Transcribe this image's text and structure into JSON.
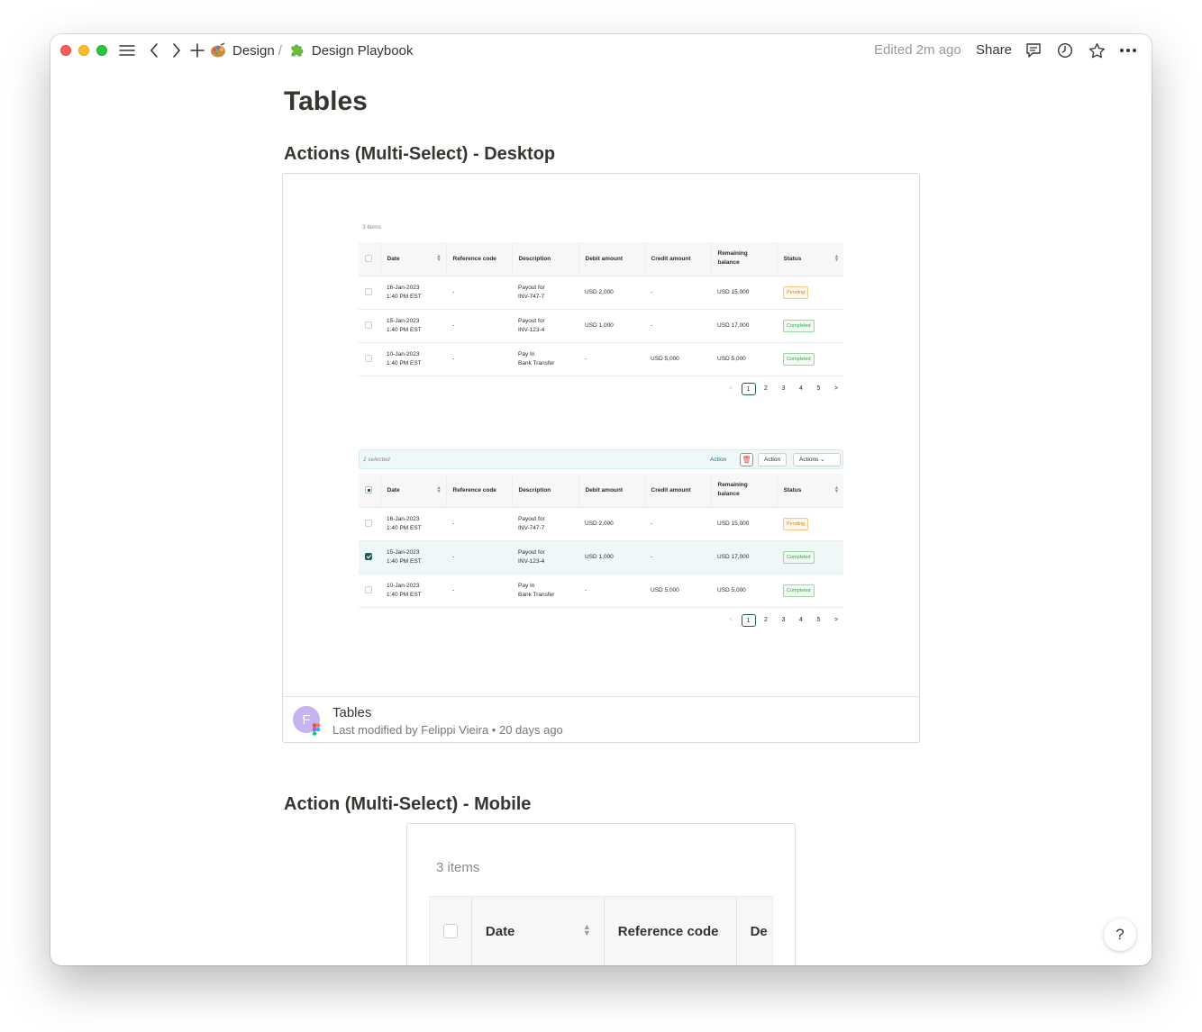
{
  "titlebar": {
    "breadcrumb_parent": "Design",
    "breadcrumb_separator": "/",
    "breadcrumb_current": "Design Playbook",
    "edited": "Edited 2m ago",
    "share_label": "Share"
  },
  "page": {
    "title": "Tables",
    "section1_heading": "Actions (Multi-Select) - Desktop",
    "section2_heading": "Action (Multi-Select) - Mobile"
  },
  "embed": {
    "title": "Tables",
    "subtitle": "Last modified by Felippi Vieira • 20 days ago",
    "avatar_letter": "F"
  },
  "desktop_table": {
    "items_label": "3 items",
    "headers": [
      "Date",
      "Reference code",
      "Description",
      "Debit amount",
      "Credit amount",
      "Remaining balance",
      "Status"
    ],
    "rows": [
      {
        "date": "16-Jan-2023",
        "time": "1:40 PM EST",
        "ref": "-",
        "desc1": "Payout for",
        "desc2": "INV-747-7",
        "debit": "USD 2,000",
        "credit": "-",
        "balance": "USD 15,000",
        "status": "Pending"
      },
      {
        "date": "15-Jan-2023",
        "time": "1:40 PM EST",
        "ref": "-",
        "desc1": "Payout for",
        "desc2": "INV-123-4",
        "debit": "USD 1,000",
        "credit": "-",
        "balance": "USD 17,000",
        "status": "Completed"
      },
      {
        "date": "10-Jan-2023",
        "time": "1:40 PM EST",
        "ref": "-",
        "desc1": "Pay In",
        "desc2": "Bank Transfer",
        "debit": "-",
        "credit": "USD 5,000",
        "balance": "USD 5,000",
        "status": "Completed"
      }
    ],
    "pages": [
      "1",
      "2",
      "3",
      "4",
      "5"
    ],
    "prev": "<",
    "next": ">"
  },
  "bulk_bar": {
    "selected_label": "1 selected",
    "action_link": "Action",
    "action_button": "Action",
    "actions_dropdown": "Actions"
  },
  "mobile_table": {
    "items_label": "3 items",
    "headers": [
      "Date",
      "Reference code",
      "De"
    ]
  },
  "help": {
    "label": "?"
  },
  "colors": {
    "accent": "#1f5d59",
    "pending": "#d4862a",
    "completed": "#3ca34a"
  }
}
